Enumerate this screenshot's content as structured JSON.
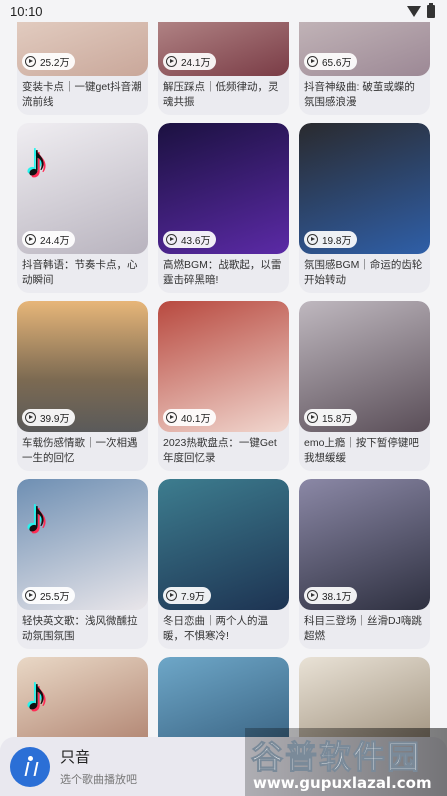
{
  "status_bar": {
    "time": "10:10"
  },
  "cards": [
    {
      "count": "25.2万",
      "title": "变装卡点｜一键get抖音潮流前线",
      "bg": "linear-gradient(160deg,#f4e7dc,#c9a79a)",
      "tiktok": true
    },
    {
      "count": "24.1万",
      "title": "解压踩点｜低频律动，灵魂共振",
      "bg": "linear-gradient(160deg,#d8b7b2,#7a3c46)",
      "tiktok": false
    },
    {
      "count": "65.6万",
      "title": "抖音神级曲: 破茧或蝶的氛围感浪漫",
      "bg": "linear-gradient(160deg,#dcd3d0,#9c8895)",
      "tiktok": true
    },
    {
      "count": "24.4万",
      "title": "抖音韩语：节奏卡点，心动瞬间",
      "bg": "linear-gradient(160deg,#f0eef2,#b8b3be)",
      "tiktok": true
    },
    {
      "count": "43.6万",
      "title": "高燃BGM：战歌起，以雷霆击碎黑暗!",
      "bg": "linear-gradient(160deg,#1b1140,#5b2aa6)",
      "tiktok": false
    },
    {
      "count": "19.8万",
      "title": "氛围感BGM｜命运的齿轮开始转动",
      "bg": "linear-gradient(160deg,#2a2a2e,#2f5fa8)",
      "tiktok": false
    },
    {
      "count": "39.9万",
      "title": "车载伤感情歌｜一次相遇一生的回忆",
      "bg": "linear-gradient(180deg,#e7b679,#7c6a52 60%,#5a5a5a)",
      "tiktok": false
    },
    {
      "count": "40.1万",
      "title": "2023热歌盘点：一键Get年度回忆录",
      "bg": "linear-gradient(160deg,#b8493f,#f1d7cf)",
      "tiktok": false
    },
    {
      "count": "15.8万",
      "title": "emo上瘾｜按下暂停键吧我想缓缓",
      "bg": "linear-gradient(160deg,#bfb8bf,#5a4e58)",
      "tiktok": false
    },
    {
      "count": "25.5万",
      "title": "轻快英文歌：浅风微醺拉动氛围氛围",
      "bg": "linear-gradient(160deg,#6e8fb3,#e9e6ea)",
      "tiktok": true
    },
    {
      "count": "7.9万",
      "title": "冬日恋曲｜两个人的温暖，不惧寒冷!",
      "bg": "linear-gradient(160deg,#3d7d8f,#1d3352)",
      "tiktok": false
    },
    {
      "count": "38.1万",
      "title": "科目三登场｜丝滑DJ嗨跳超燃",
      "bg": "linear-gradient(160deg,#8b88a6,#2e3040)",
      "tiktok": false
    },
    {
      "count": "",
      "title": "",
      "bg": "linear-gradient(160deg,#e9d8c6,#a06b58)",
      "tiktok": true
    },
    {
      "count": "",
      "title": "",
      "bg": "linear-gradient(160deg,#6ea7c8,#2a4f6e)",
      "tiktok": false
    },
    {
      "count": "",
      "title": "",
      "bg": "linear-gradient(160deg,#e9e2d6,#8a7a64)",
      "tiktok": false
    }
  ],
  "player": {
    "title": "只音",
    "subtitle": "选个歌曲播放吧"
  },
  "watermark": {
    "main": "谷普软件园",
    "url": "www.gupuxlazal.com"
  }
}
